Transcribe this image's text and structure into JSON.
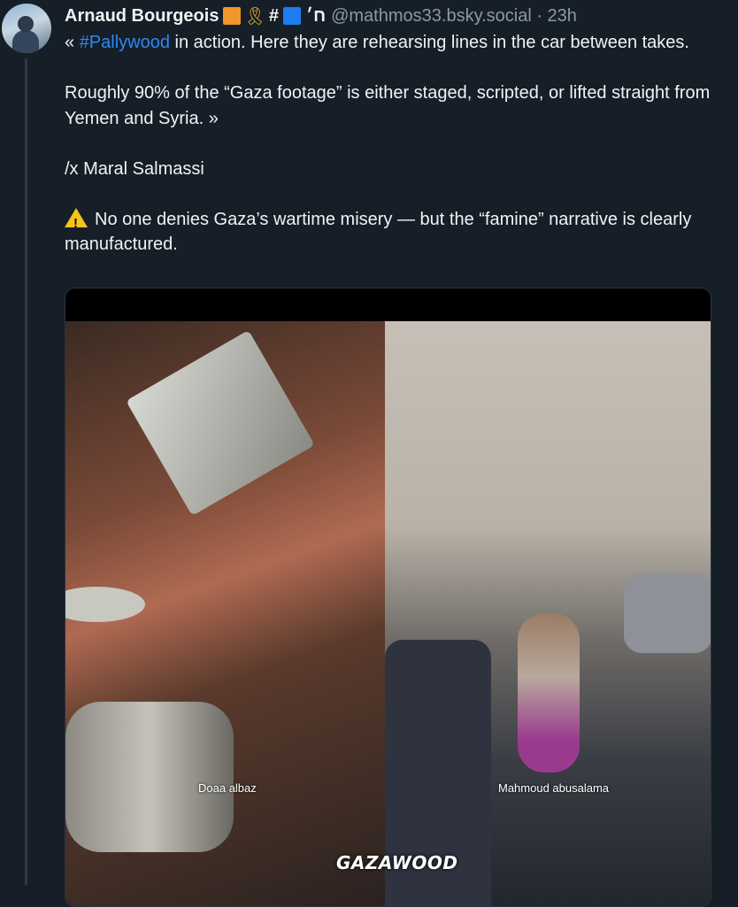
{
  "post": {
    "author_name": "Arnaud Bourgeois",
    "author_badges": {
      "hash": "#",
      "hebrew": "ח׳"
    },
    "handle": "@mathmos33.bsky.social · 23h",
    "text": {
      "p1_open": "« ",
      "p1_hashtag": "#Pallywood",
      "p1_rest": " in action. Here they are rehearsing lines in the car between takes.",
      "p2": "Roughly 90% of the “Gaza footage” is either staged, scripted, or lifted straight from Yemen and Syria. »",
      "p3": "/x Maral Salmassi",
      "p4": "No one denies Gaza’s wartime misery — but the “famine” narrative is clearly manufactured."
    },
    "media": {
      "left_caption": "Doaa albaz",
      "right_caption": "Mahmoud abusalama",
      "brand": "GAZAWOOD"
    }
  },
  "colors": {
    "background": "#161e27",
    "link": "#2f88f0",
    "handle": "#8a99ab"
  }
}
